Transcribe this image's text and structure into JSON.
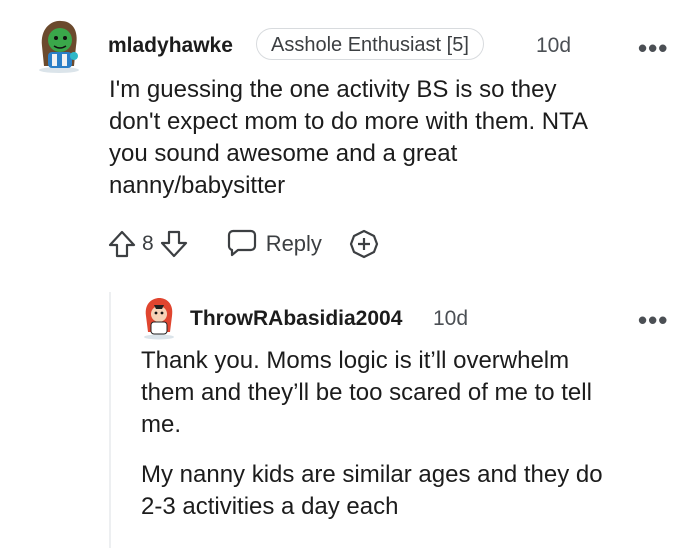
{
  "comment": {
    "username": "mladyhawke",
    "flair": "Asshole Enthusiast [5]",
    "timestamp": "10d",
    "more": "•••",
    "body_lines": [
      "I'm guessing the one activity BS is so they",
      "don't expect mom to do more with them. NTA",
      "you sound awesome and a great",
      "nanny/babysitter"
    ],
    "vote_count": "8",
    "reply_label": "Reply"
  },
  "reply": {
    "username": "ThrowRAbasidia2004",
    "timestamp": "10d",
    "more": "•••",
    "paragraph1_lines": [
      "Thank you. Moms logic is it’ll overwhelm",
      "them and they’ll be too scared of me to tell",
      "me."
    ],
    "paragraph2_lines": [
      "My nanny kids are similar ages and they do",
      "2-3 activities a day each"
    ]
  },
  "icons": {
    "upvote": "arrow-up-outline-icon",
    "downvote": "arrow-down-outline-icon",
    "reply": "speech-bubble-icon",
    "award": "plus-circle-icon",
    "more": "ellipsis-icon"
  }
}
